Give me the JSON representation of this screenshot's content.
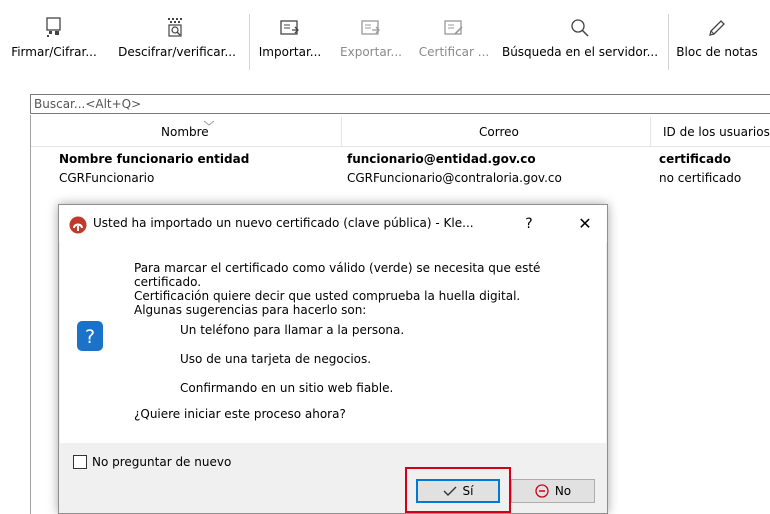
{
  "toolbar": {
    "sign_encrypt": "Firmar/Cifrar...",
    "decrypt_verify": "Descifrar/verificar...",
    "import": "Importar...",
    "export": "Exportar...",
    "certify": "Certificar ...",
    "server_search": "Búsqueda en el servidor...",
    "notepad": "Bloc de notas"
  },
  "search": {
    "placeholder": "Buscar...<Alt+Q>"
  },
  "table": {
    "columns": [
      "Nombre",
      "Correo",
      "ID de los usuarios"
    ],
    "rows": [
      {
        "name": "Nombre funcionario entidad",
        "email": "funcionario@entidad.gov.co",
        "uid": "certificado"
      },
      {
        "name": "CGRFuncionario",
        "email": "CGRFuncionario@contraloria.gov.co",
        "uid": "no certificado"
      }
    ]
  },
  "dialog": {
    "title": "Usted ha importado un nuevo certificado (clave pública) - Kle...",
    "help": "?",
    "close": "✕",
    "message_lines": [
      "Para marcar el certificado como válido (verde) se necesita que esté certificado.",
      "Certificación quiere decir que usted comprueba la huella digital.",
      "Algunas sugerencias para hacerlo son:"
    ],
    "suggestions": [
      "Un teléfono para llamar a la persona.",
      "Uso de una tarjeta de negocios.",
      "Confirmando en un sitio web fiable."
    ],
    "question": "¿Quiere iniciar este proceso ahora?",
    "dont_ask": "No preguntar de nuevo",
    "yes": "Sí",
    "no": "No"
  },
  "colors": {
    "highlight_frame": "#d0021b",
    "default_button_border": "#0078d7",
    "question_icon": "#1a73c9",
    "app_icon": "#c0392b"
  }
}
